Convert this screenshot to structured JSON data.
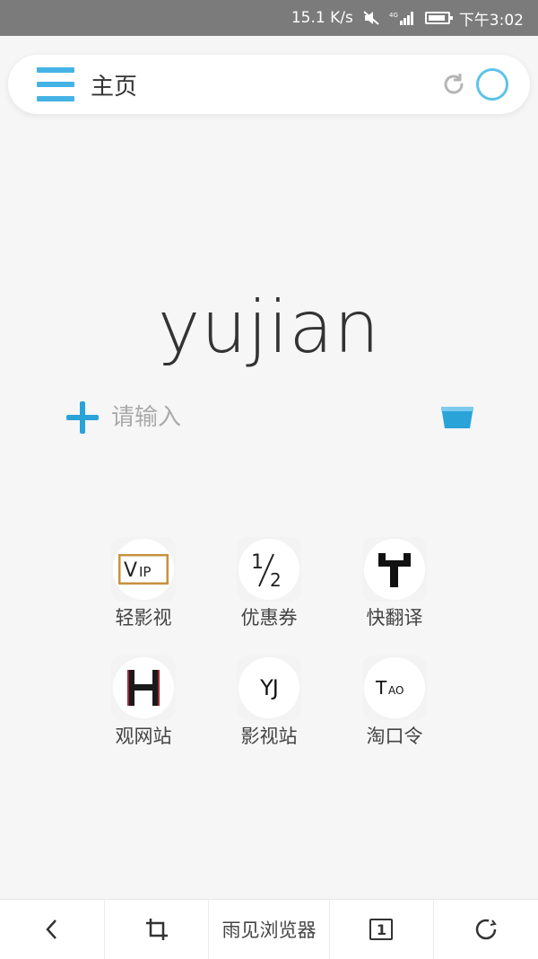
{
  "status_bar": {
    "speed": "15.1 K/s",
    "network": "4G",
    "time": "下午3:02"
  },
  "top_bar": {
    "title": "主页",
    "icons": [
      "menu-icon",
      "refresh-icon",
      "circle-icon"
    ]
  },
  "logo": "yujian",
  "search": {
    "placeholder": "请输入",
    "value": ""
  },
  "shortcuts": [
    {
      "label": "轻影视",
      "icon": "vip-icon",
      "icon_text": "VIP"
    },
    {
      "label": "优惠券",
      "icon": "half-icon",
      "icon_text": "½"
    },
    {
      "label": "快翻译",
      "icon": "translate-icon",
      "icon_text": ""
    },
    {
      "label": "观网站",
      "icon": "h-icon",
      "icon_text": "H"
    },
    {
      "label": "影视站",
      "icon": "yj-icon",
      "icon_text": "YJ"
    },
    {
      "label": "淘口令",
      "icon": "tao-icon",
      "icon_text": "TAO"
    }
  ],
  "bottom_bar": {
    "title": "雨见浏览器",
    "tab_count": "1",
    "icons": [
      "back-icon",
      "crop-icon",
      "tabs-icon",
      "sync-icon"
    ]
  },
  "colors": {
    "accent": "#45b3e6",
    "plus": "#2aa3d8",
    "status_bar": "#7b7b7b",
    "background": "#f6f6f6"
  }
}
